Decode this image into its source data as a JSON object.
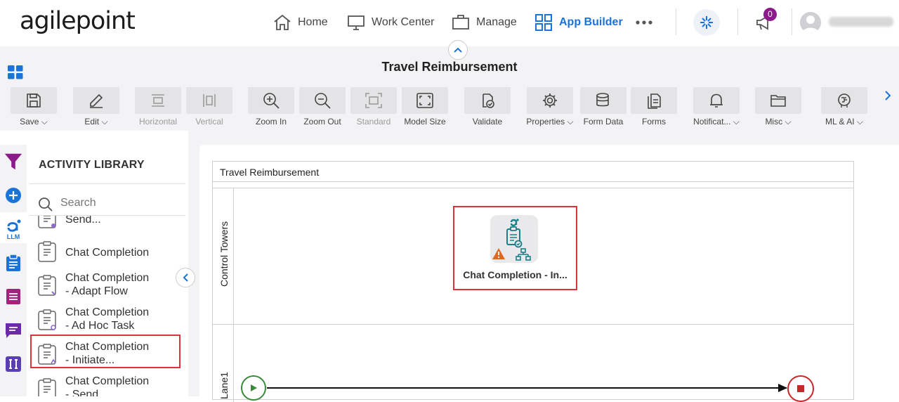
{
  "brand": {
    "logo_text": "agilepoint",
    "accent_color": "#1a73d9",
    "logo_dot_color": "#1a73d9"
  },
  "nav": {
    "home": "Home",
    "work_center": "Work Center",
    "manage": "Manage",
    "app_builder": "App Builder",
    "notifications_count": "0"
  },
  "app": {
    "title": "Travel Reimbursement"
  },
  "toolbar": {
    "items": [
      {
        "label": "Save",
        "icon": "save-icon",
        "dropdown": true,
        "enabled": true
      },
      {
        "label": "Edit",
        "icon": "edit-icon",
        "dropdown": true,
        "enabled": true
      },
      {
        "label": "Horizontal",
        "icon": "horizontal-layout-icon",
        "dropdown": false,
        "enabled": false
      },
      {
        "label": "Vertical",
        "icon": "vertical-layout-icon",
        "dropdown": false,
        "enabled": false
      },
      {
        "label": "Zoom In",
        "icon": "zoom-in-icon",
        "dropdown": false,
        "enabled": true
      },
      {
        "label": "Zoom Out",
        "icon": "zoom-out-icon",
        "dropdown": false,
        "enabled": true
      },
      {
        "label": "Standard",
        "icon": "standard-size-icon",
        "dropdown": false,
        "enabled": false
      },
      {
        "label": "Model Size",
        "icon": "model-size-icon",
        "dropdown": false,
        "enabled": true
      },
      {
        "label": "Validate",
        "icon": "validate-icon",
        "dropdown": false,
        "enabled": true
      },
      {
        "label": "Properties",
        "icon": "gear-icon",
        "dropdown": true,
        "enabled": true
      },
      {
        "label": "Form Data",
        "icon": "database-icon",
        "dropdown": false,
        "enabled": true
      },
      {
        "label": "Forms",
        "icon": "forms-icon",
        "dropdown": false,
        "enabled": true
      },
      {
        "label": "Notificat...",
        "icon": "bell-icon",
        "dropdown": true,
        "enabled": true
      },
      {
        "label": "Misc",
        "icon": "folder-icon",
        "dropdown": true,
        "enabled": true
      },
      {
        "label": "ML & AI",
        "icon": "brain-icon",
        "dropdown": true,
        "enabled": true
      }
    ]
  },
  "rail": {
    "llm_label": "LLM"
  },
  "library": {
    "title": "ACTIVITY LIBRARY",
    "search_placeholder": "Search",
    "items": [
      {
        "label": "Send..."
      },
      {
        "label": "Chat Completion"
      },
      {
        "label_line1": "Chat Completion",
        "label_line2": "- Adapt Flow"
      },
      {
        "label_line1": "Chat Completion",
        "label_line2": "- Ad Hoc Task"
      },
      {
        "label_line1": "Chat Completion",
        "label_line2": "- Initiate..."
      },
      {
        "label_line1": "Chat Completion",
        "label_line2": "- Send..."
      }
    ]
  },
  "canvas": {
    "pool_title": "Travel Reimbursement",
    "lane1": "Control Towers",
    "lane2": "Lane1",
    "activity_label": "Chat Completion - In..."
  },
  "colors": {
    "selection_red": "#d9353b",
    "start_green": "#3a8a3a",
    "end_red": "#c62828",
    "rail_purple": "#8b1a8b",
    "rail_blue": "#1a73d9"
  }
}
